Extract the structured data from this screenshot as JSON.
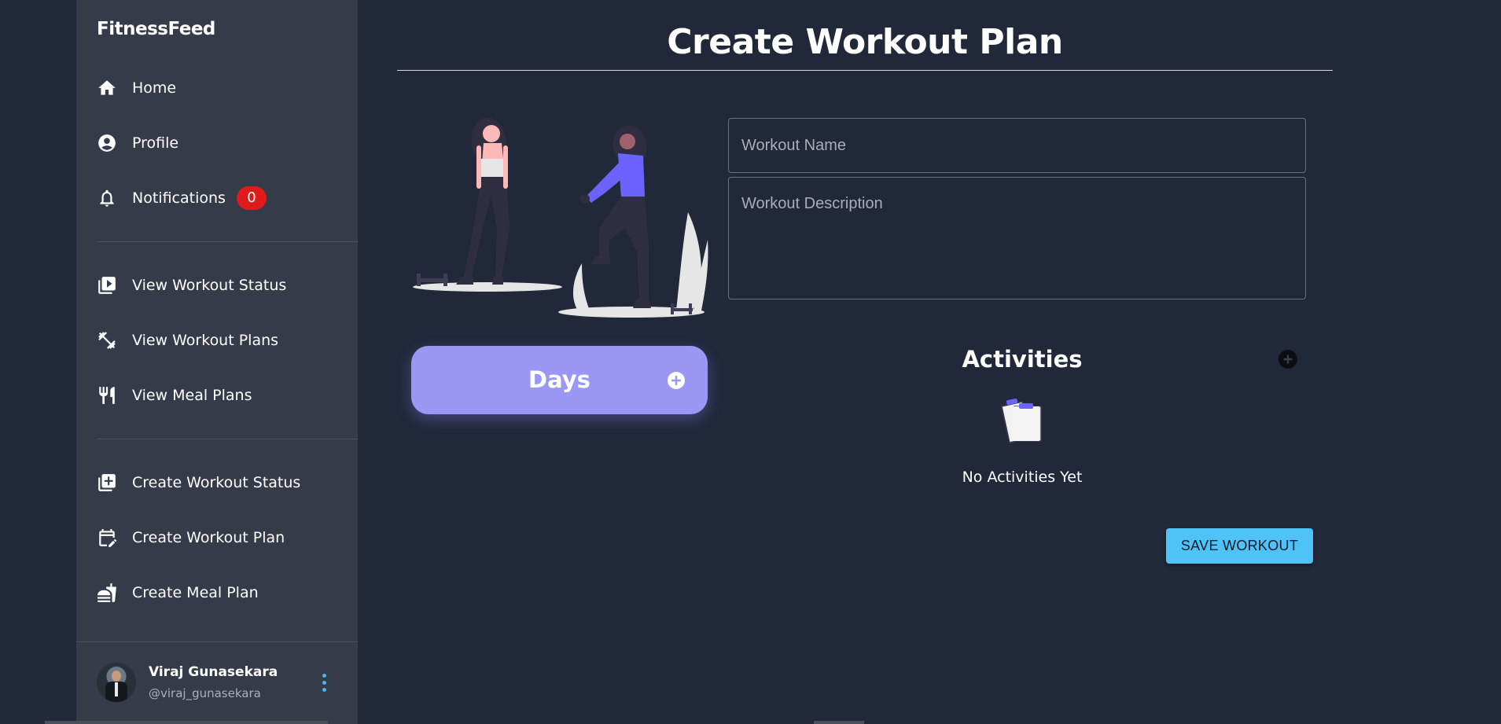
{
  "app": {
    "brand": "FitnessFeed"
  },
  "sidebar": {
    "items": [
      {
        "label": "Home",
        "icon": "home-icon"
      },
      {
        "label": "Profile",
        "icon": "account-circle-icon"
      },
      {
        "label": "Notifications",
        "icon": "bell-icon",
        "badge": "0"
      },
      {
        "label": "View Workout Status",
        "icon": "video-library-icon"
      },
      {
        "label": "View Workout Plans",
        "icon": "dumbbell-icon"
      },
      {
        "label": "View Meal Plans",
        "icon": "fork-knife-icon"
      },
      {
        "label": "Create Workout Status",
        "icon": "add-library-icon"
      },
      {
        "label": "Create Workout Plan",
        "icon": "calendar-edit-icon"
      },
      {
        "label": "Create Meal Plan",
        "icon": "fastfood-icon"
      }
    ],
    "user": {
      "name": "Viraj Gunasekara",
      "handle": "@viraj_gunasekara"
    }
  },
  "main": {
    "title": "Create Workout Plan",
    "days_label": "Days",
    "form": {
      "name_placeholder": "Workout Name",
      "description_placeholder": "Workout Description"
    },
    "activities": {
      "title": "Activities",
      "empty_text": "No Activities Yet"
    },
    "save_label": "SAVE WORKOUT"
  },
  "colors": {
    "background": "#21283a",
    "sidebar": "#353b48",
    "days_button": "#9b98f5",
    "save_button": "#4fc3f7",
    "badge": "#e01b1b",
    "accent_purple": "#6c63ff"
  }
}
